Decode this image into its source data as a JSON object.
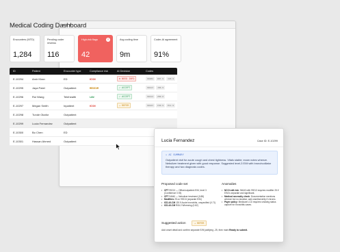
{
  "dashboard": {
    "title": "Medical Coding Dashboard"
  },
  "stats": [
    {
      "label": "Encounters (MTD)",
      "value": "1,284"
    },
    {
      "label": "Pending coder reviews",
      "value": "116"
    },
    {
      "label": "High-risk flags",
      "value": "42",
      "alert": true
    },
    {
      "label": "Avg coding time",
      "value": "9m"
    },
    {
      "label": "Coder-AI agreement",
      "value": "91%"
    }
  ],
  "table": {
    "headers": [
      "ID",
      "Patient",
      "Encounter type",
      "Compliance risk",
      "AI Decision",
      "Codes"
    ],
    "rows": [
      {
        "id": "E-10294",
        "patient": "Amir Khan",
        "type": "ED",
        "risk": "HIGH",
        "decision": "NEED INFO",
        "codes": [
          "99284",
          "R07.9",
          "I20.9"
        ]
      },
      {
        "id": "E-10295",
        "patient": "Jaya Patel",
        "type": "Outpatient",
        "risk": "MEDIUM",
        "decision": "ACCEPT",
        "codes": [
          "99213",
          "J06.9"
        ]
      },
      {
        "id": "E-10296",
        "patient": "Rui Wang",
        "type": "Telehealth",
        "risk": "LOW",
        "decision": "ACCEPT",
        "codes": [
          "99212",
          "Z00.0"
        ]
      },
      {
        "id": "E-10297",
        "patient": "Megan Smith",
        "type": "Inpatient",
        "risk": "HIGH",
        "decision": "REFER",
        "codes": [
          "99223",
          "I50.9",
          "E11.9"
        ]
      },
      {
        "id": "E-10298",
        "patient": "Tunde Okafor",
        "type": "Outpatient",
        "risk": "",
        "decision": "",
        "codes": []
      },
      {
        "id": "E-10299",
        "patient": "Lucia Fernandez",
        "type": "Outpatient",
        "risk": "",
        "decision": "",
        "codes": []
      },
      {
        "id": "E-10300",
        "patient": "Bo Chen",
        "type": "ED",
        "risk": "",
        "decision": "",
        "codes": []
      },
      {
        "id": "E-10301",
        "patient": "Hassan Ahmed",
        "type": "Outpatient",
        "risk": "",
        "decision": "",
        "codes": []
      }
    ]
  },
  "detail": {
    "patient": "Lucia Fernandez",
    "case_id": "Case ID: E-10299",
    "summary_title": "AI SUMMARY",
    "summary_text": "Outpatient visit for acute cough and chest tightness. Vitals stable; exam notes wheeze. Nebulizer treatment given with good response. Suggested level-3 E/M with bronchodilator therapy and two diagnosis codes.",
    "codes_title": "Proposed code set",
    "codes": [
      {
        "code": "CPT",
        "text": "99213 — Office/outpatient E/M, level 3 (Confidence 0.93)"
      },
      {
        "code": "CPT",
        "text": "94640 — Nebulizer treatment (0.88)"
      },
      {
        "code": "Modifiers",
        "text": "25 on 99213 (separate E/M)"
      },
      {
        "code": "ICD-10-CM",
        "text": "J20.9 Acute bronchitis, unspecified (0.71)"
      },
      {
        "code": "ICD-10-CM",
        "text": "R06.2 Wheezing (0.82)"
      }
    ],
    "anomalies_title": "Anomalies",
    "anomalies": [
      {
        "code": "NCCI edit risk",
        "text": "94640 with 99213 requires modifier 25 if E/M is separate and significant."
      },
      {
        "code": "Medical necessity check",
        "text": "Documentation mentions wheeze but no duration; add onset/severity if chronic."
      },
      {
        "code": "Payer policy",
        "text": "Medicare LCD requires smoking status capture for bronchitis cases."
      }
    ],
    "action_title": "Suggested action",
    "action_badge": "REFER",
    "action_text_pre": "Add onset detail and confirm separate E/M justifying -25, then mark",
    "action_text_bold": "Ready to submit."
  }
}
